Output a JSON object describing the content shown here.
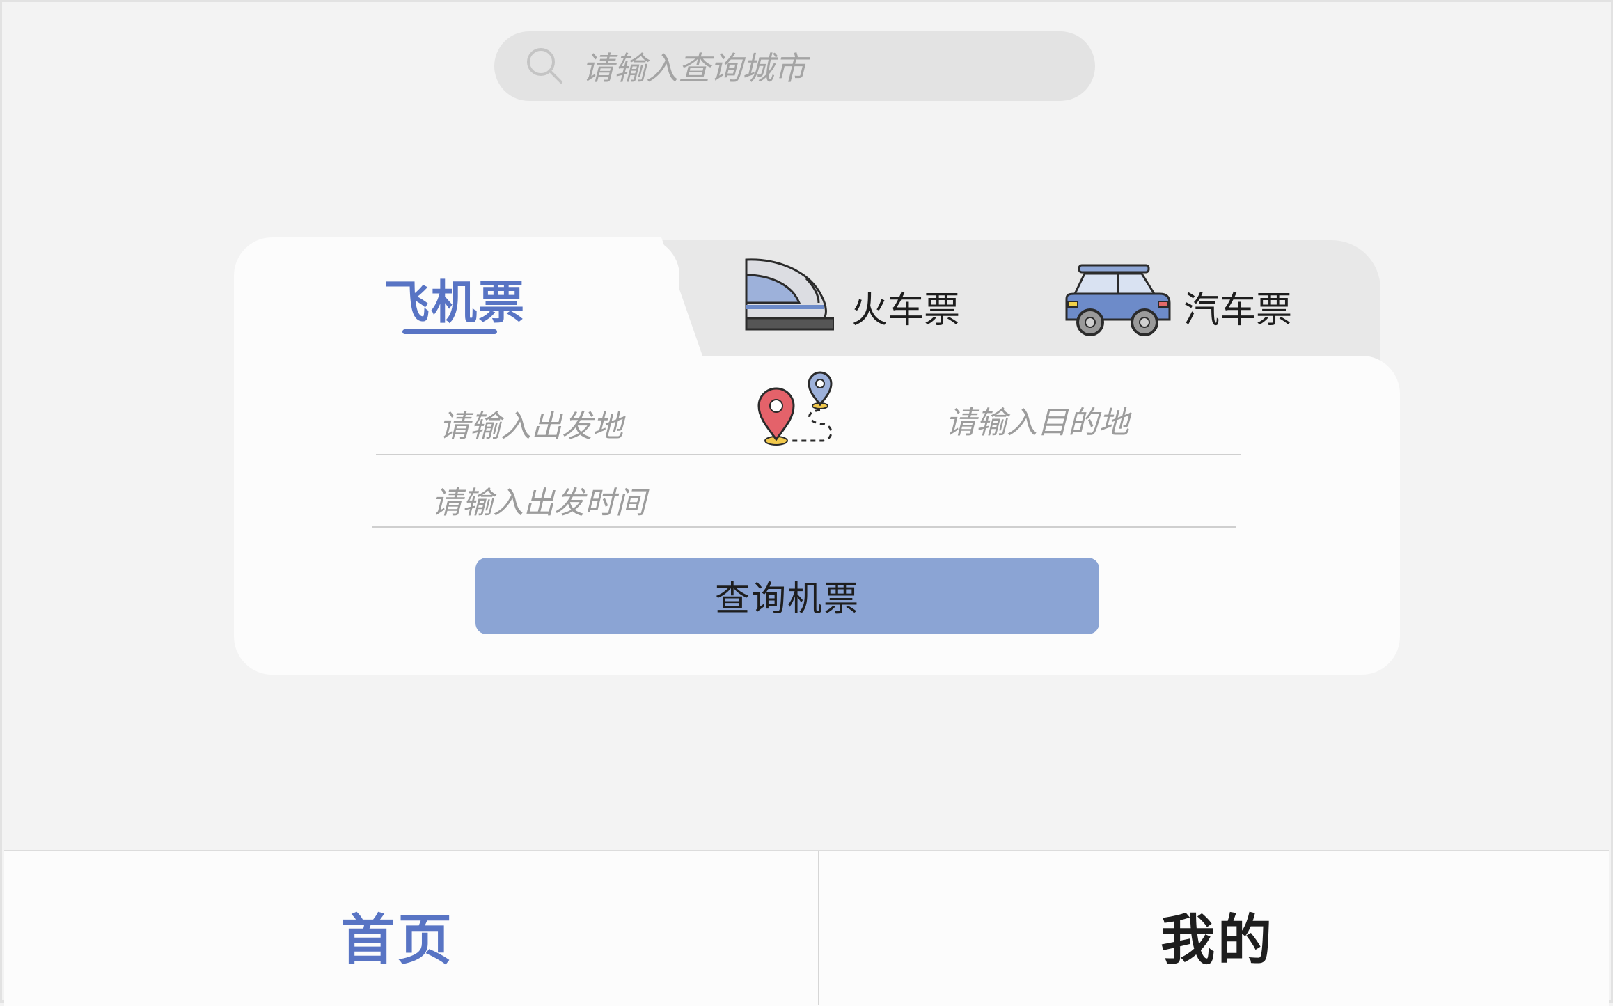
{
  "search": {
    "placeholder": "请输入查询城市"
  },
  "tabs": [
    {
      "label": "飞机票",
      "active": true,
      "icon": "plane"
    },
    {
      "label": "火车票",
      "active": false,
      "icon": "train-icon"
    },
    {
      "label": "汽车票",
      "active": false,
      "icon": "car-icon"
    }
  ],
  "form": {
    "from_placeholder": "请输入出发地",
    "to_placeholder": "请输入目的地",
    "date_placeholder": "请输入出发时间",
    "route_icon": "route-pins-icon",
    "submit_label": "查询机票"
  },
  "nav": {
    "items": [
      {
        "label": "首页",
        "active": true
      },
      {
        "label": "我的",
        "active": false
      }
    ]
  },
  "colors": {
    "accent": "#5874c4",
    "button": "#8ba4d4",
    "background": "#f3f3f3",
    "card": "#fcfcfc"
  }
}
